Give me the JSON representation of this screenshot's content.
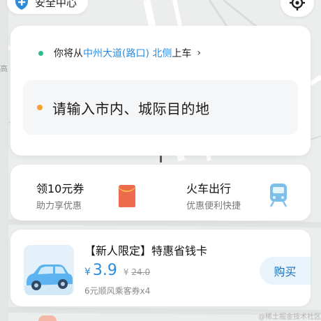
{
  "top_bar": {
    "safety_label": "安全中心",
    "safety_icon": "shield-plus-icon",
    "locate_icon": "locate-icon"
  },
  "map": {
    "side_label": "高"
  },
  "pickup": {
    "prefix": "你将从 ",
    "road": "中州大道",
    "detail": "(路口) 北侧",
    "suffix": "上车",
    "arrow": "›"
  },
  "destination": {
    "placeholder": "请输入市内、城际目的地"
  },
  "services": [
    {
      "title": "领10元券",
      "subtitle": "助力享优惠",
      "icon": "red-packet-icon"
    },
    {
      "title": "火车出行",
      "subtitle": "优惠便利快捷",
      "icon": "train-icon"
    }
  ],
  "promo": {
    "title": "【新人限定】特惠省钱卡",
    "price_symbol": "¥",
    "price": "3.9",
    "old_price_symbol": "¥",
    "old_price": "24.0",
    "description": "6元顺风乘客券x4",
    "buy_label": "购买",
    "thumb_icon": "car-icon"
  },
  "watermark": "@稀土掘金技术社区",
  "colors": {
    "accent": "#2c8cdc",
    "pickup_dot": "#2bbf8a",
    "destination_dot": "#f5a233",
    "coupon_red": "#ee6a4d"
  }
}
